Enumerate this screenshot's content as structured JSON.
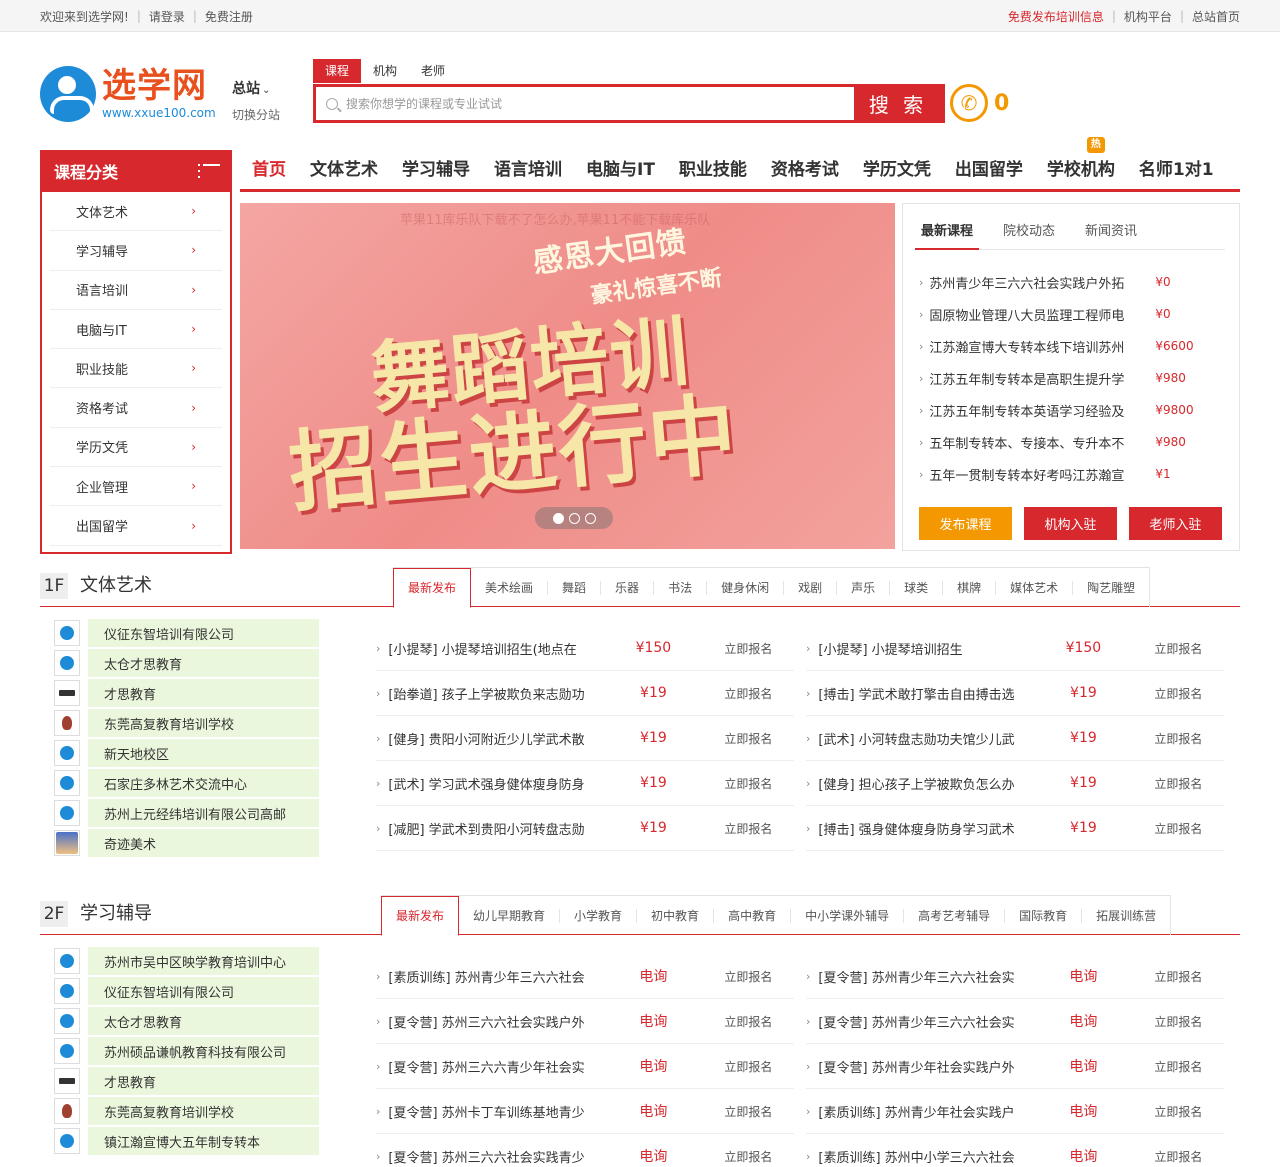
{
  "topbar": {
    "welcome": "欢迎来到选学网!",
    "login": "请登录",
    "register": "免费注册",
    "publish": "免费发布培训信息",
    "org_platform": "机构平台",
    "home": "总站首页"
  },
  "header": {
    "logo_name": "选学网",
    "logo_url": "www.xxue100.com",
    "station": "总站",
    "switch_station": "切换分站",
    "phone_number": "0"
  },
  "search": {
    "tabs": [
      "课程",
      "机构",
      "老师"
    ],
    "placeholder": "搜索你想学的课程或专业试试",
    "button": "搜 索"
  },
  "category": {
    "title": "课程分类",
    "items": [
      "文体艺术",
      "学习辅导",
      "语言培训",
      "电脑与IT",
      "职业技能",
      "资格考试",
      "学历文凭",
      "企业管理",
      "出国留学"
    ]
  },
  "nav": {
    "items": [
      "首页",
      "文体艺术",
      "学习辅导",
      "语言培训",
      "电脑与IT",
      "职业技能",
      "资格考试",
      "学历文凭",
      "出国留学",
      "学校机构",
      "名师1对1"
    ],
    "hot_badge": "热"
  },
  "banner": {
    "ghost_text": "苹果11库乐队下载不了怎么办,苹果11不能下载库乐队",
    "line1": "感恩大回馈",
    "line2": "豪礼惊喜不断",
    "line3": "舞蹈培训",
    "line4": "招生进行中"
  },
  "news": {
    "tabs": [
      "最新课程",
      "院校动态",
      "新闻资讯"
    ],
    "items": [
      {
        "title": "苏州青少年三六六社会实践户外拓",
        "price": "¥0"
      },
      {
        "title": "固原物业管理八大员监理工程师电",
        "price": "¥0"
      },
      {
        "title": "江苏瀚宣博大专转本线下培训苏州",
        "price": "¥6600"
      },
      {
        "title": "江苏五年制专转本是高职生提升学",
        "price": "¥980"
      },
      {
        "title": "江苏五年制专转本英语学习经验及",
        "price": "¥9800"
      },
      {
        "title": "五年制专转本、专接本、专升本不",
        "price": "¥980"
      },
      {
        "title": "五年一贯制专转本好考吗江苏瀚宣",
        "price": "¥1"
      }
    ],
    "buttons": [
      "发布课程",
      "机构入驻",
      "老师入驻"
    ]
  },
  "floor1": {
    "num": "1F",
    "title": "文体艺术",
    "tabs": [
      "最新发布",
      "美术绘画",
      "舞蹈",
      "乐器",
      "书法",
      "健身休闲",
      "戏剧",
      "声乐",
      "球类",
      "棋牌",
      "媒体艺术",
      "陶艺雕塑"
    ],
    "orgs": [
      "仪征东智培训有限公司",
      "太仓才思教育",
      "才思教育",
      "东莞高复教育培训学校",
      "新天地校区",
      "石家庄多林艺术交流中心",
      "苏州上元经纬培训有限公司高邮",
      "奇迹美术"
    ],
    "sign_label": "立即报名",
    "courses": [
      {
        "title": "[小提琴] 小提琴培训招生(地点在",
        "price": "¥150"
      },
      {
        "title": "[小提琴] 小提琴培训招生",
        "price": "¥150"
      },
      {
        "title": "[跆拳道] 孩子上学被欺负来志勋功",
        "price": "¥19"
      },
      {
        "title": "[搏击] 学武术敢打擎击自由搏击选",
        "price": "¥19"
      },
      {
        "title": "[健身] 贵阳小河附近少儿学武术散",
        "price": "¥19"
      },
      {
        "title": "[武术] 小河转盘志勋功夫馆少儿武",
        "price": "¥19"
      },
      {
        "title": "[武术] 学习武术强身健体瘦身防身",
        "price": "¥19"
      },
      {
        "title": "[健身] 担心孩子上学被欺负怎么办",
        "price": "¥19"
      },
      {
        "title": "[减肥] 学武术到贵阳小河转盘志勋",
        "price": "¥19"
      },
      {
        "title": "[搏击] 强身健体瘦身防身学习武术",
        "price": "¥19"
      }
    ]
  },
  "floor2": {
    "num": "2F",
    "title": "学习辅导",
    "tabs": [
      "最新发布",
      "幼儿早期教育",
      "小学教育",
      "初中教育",
      "高中教育",
      "中小学课外辅导",
      "高考艺考辅导",
      "国际教育",
      "拓展训练营"
    ],
    "orgs": [
      "苏州市吴中区映学教育培训中心",
      "仪征东智培训有限公司",
      "太仓才思教育",
      "苏州硕品谦帆教育科技有限公司",
      "才思教育",
      "东莞高复教育培训学校",
      "镇江瀚宣博大五年制专转本"
    ],
    "sign_label": "立即报名",
    "courses": [
      {
        "title": "[素质训练] 苏州青少年三六六社会",
        "price": "电询"
      },
      {
        "title": "[夏令营] 苏州青少年三六六社会实",
        "price": "电询"
      },
      {
        "title": "[夏令营] 苏州三六六社会实践户外",
        "price": "电询"
      },
      {
        "title": "[夏令营] 苏州青少年三六六社会实",
        "price": "电询"
      },
      {
        "title": "[夏令营] 苏州三六六青少年社会实",
        "price": "电询"
      },
      {
        "title": "[夏令营] 苏州青少年社会实践户外",
        "price": "电询"
      },
      {
        "title": "[夏令营] 苏州卡丁车训练基地青少",
        "price": "电询"
      },
      {
        "title": "[素质训练] 苏州青少年社会实践户",
        "price": "电询"
      },
      {
        "title": "[夏令营] 苏州三六六社会实践青少",
        "price": "电询"
      },
      {
        "title": "[素质训练] 苏州中小学三六六社会",
        "price": "电询"
      }
    ]
  },
  "colors": {
    "brand_red": "#d7282e",
    "orange": "#f39800",
    "org_bg": "#eaf7dc",
    "logo_blue": "#1d8bd8"
  }
}
